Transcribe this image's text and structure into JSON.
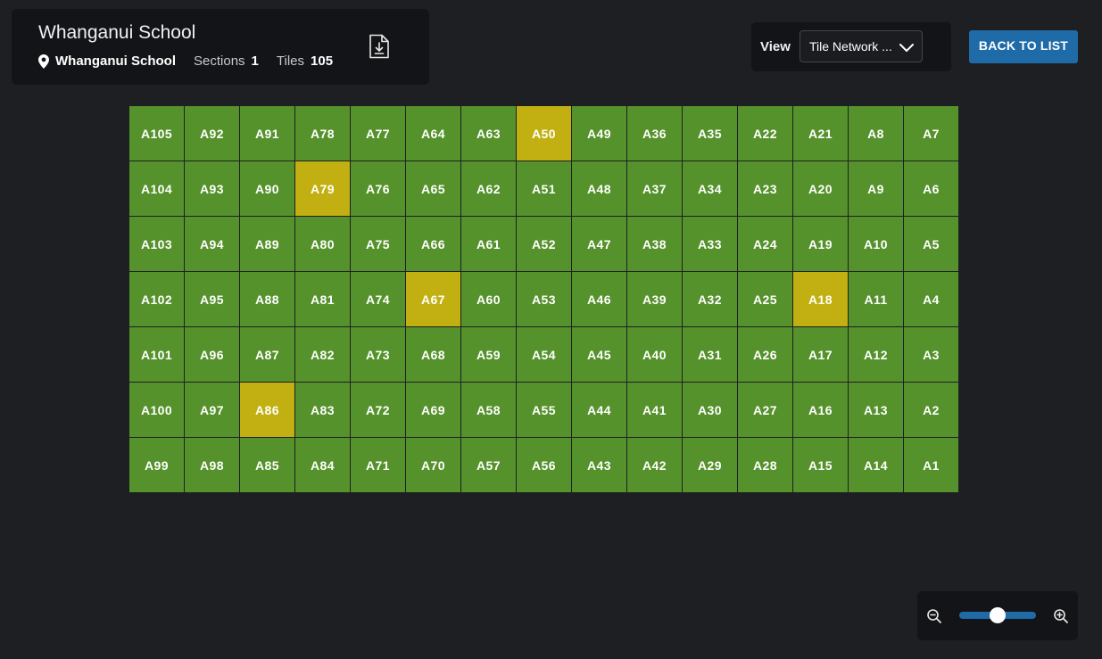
{
  "header": {
    "title": "Whanganui School",
    "school_name": "Whanganui School",
    "sections_label": "Sections",
    "sections_value": "1",
    "tiles_label": "Tiles",
    "tiles_value": "105",
    "download_icon": "file-download-icon",
    "location_icon": "map-pin-icon"
  },
  "view": {
    "label": "View",
    "selected": "Tile Network ...",
    "chevron_icon": "chevron-down-icon"
  },
  "back_button": {
    "label": "BACK TO LIST"
  },
  "colors": {
    "tile_ok": "#55922b",
    "tile_warning": "#c2b012",
    "accent": "#1f6ba8"
  },
  "tiles": {
    "rows": [
      [
        {
          "id": "A105"
        },
        {
          "id": "A92"
        },
        {
          "id": "A91"
        },
        {
          "id": "A78"
        },
        {
          "id": "A77"
        },
        {
          "id": "A64"
        },
        {
          "id": "A63"
        },
        {
          "id": "A50",
          "status": "warning"
        },
        {
          "id": "A49"
        },
        {
          "id": "A36"
        },
        {
          "id": "A35"
        },
        {
          "id": "A22"
        },
        {
          "id": "A21"
        },
        {
          "id": "A8"
        },
        {
          "id": "A7"
        }
      ],
      [
        {
          "id": "A104"
        },
        {
          "id": "A93"
        },
        {
          "id": "A90"
        },
        {
          "id": "A79",
          "status": "warning"
        },
        {
          "id": "A76"
        },
        {
          "id": "A65"
        },
        {
          "id": "A62"
        },
        {
          "id": "A51"
        },
        {
          "id": "A48"
        },
        {
          "id": "A37"
        },
        {
          "id": "A34"
        },
        {
          "id": "A23"
        },
        {
          "id": "A20"
        },
        {
          "id": "A9"
        },
        {
          "id": "A6"
        }
      ],
      [
        {
          "id": "A103"
        },
        {
          "id": "A94"
        },
        {
          "id": "A89"
        },
        {
          "id": "A80"
        },
        {
          "id": "A75"
        },
        {
          "id": "A66"
        },
        {
          "id": "A61"
        },
        {
          "id": "A52"
        },
        {
          "id": "A47"
        },
        {
          "id": "A38"
        },
        {
          "id": "A33"
        },
        {
          "id": "A24"
        },
        {
          "id": "A19"
        },
        {
          "id": "A10"
        },
        {
          "id": "A5"
        }
      ],
      [
        {
          "id": "A102"
        },
        {
          "id": "A95"
        },
        {
          "id": "A88"
        },
        {
          "id": "A81"
        },
        {
          "id": "A74"
        },
        {
          "id": "A67",
          "status": "warning"
        },
        {
          "id": "A60"
        },
        {
          "id": "A53"
        },
        {
          "id": "A46"
        },
        {
          "id": "A39"
        },
        {
          "id": "A32"
        },
        {
          "id": "A25"
        },
        {
          "id": "A18",
          "status": "warning"
        },
        {
          "id": "A11"
        },
        {
          "id": "A4"
        }
      ],
      [
        {
          "id": "A101"
        },
        {
          "id": "A96"
        },
        {
          "id": "A87"
        },
        {
          "id": "A82"
        },
        {
          "id": "A73"
        },
        {
          "id": "A68"
        },
        {
          "id": "A59"
        },
        {
          "id": "A54"
        },
        {
          "id": "A45"
        },
        {
          "id": "A40"
        },
        {
          "id": "A31"
        },
        {
          "id": "A26"
        },
        {
          "id": "A17"
        },
        {
          "id": "A12"
        },
        {
          "id": "A3"
        }
      ],
      [
        {
          "id": "A100"
        },
        {
          "id": "A97"
        },
        {
          "id": "A86",
          "status": "warning"
        },
        {
          "id": "A83"
        },
        {
          "id": "A72"
        },
        {
          "id": "A69"
        },
        {
          "id": "A58"
        },
        {
          "id": "A55"
        },
        {
          "id": "A44"
        },
        {
          "id": "A41"
        },
        {
          "id": "A30"
        },
        {
          "id": "A27"
        },
        {
          "id": "A16"
        },
        {
          "id": "A13"
        },
        {
          "id": "A2"
        }
      ],
      [
        {
          "id": "A99"
        },
        {
          "id": "A98"
        },
        {
          "id": "A85"
        },
        {
          "id": "A84"
        },
        {
          "id": "A71"
        },
        {
          "id": "A70"
        },
        {
          "id": "A57"
        },
        {
          "id": "A56"
        },
        {
          "id": "A43"
        },
        {
          "id": "A42"
        },
        {
          "id": "A29"
        },
        {
          "id": "A28"
        },
        {
          "id": "A15"
        },
        {
          "id": "A14"
        },
        {
          "id": "A1"
        }
      ]
    ]
  },
  "zoom": {
    "zoom_out_icon": "zoom-out-icon",
    "zoom_in_icon": "zoom-in-icon",
    "level": 0.5
  }
}
